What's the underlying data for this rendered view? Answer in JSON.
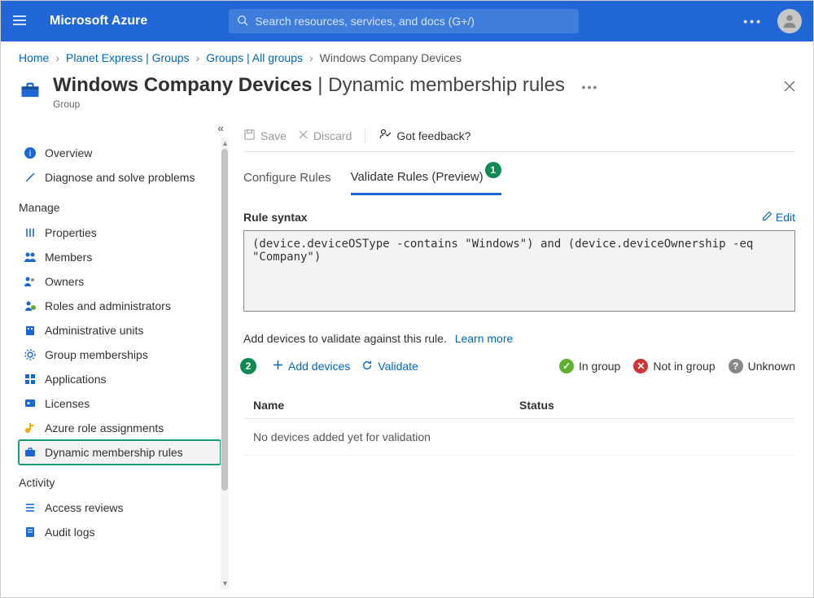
{
  "topbar": {
    "brand": "Microsoft Azure",
    "search_placeholder": "Search resources, services, and docs (G+/)"
  },
  "breadcrumb": {
    "items": [
      "Home",
      "Planet Express | Groups",
      "Groups | All groups",
      "Windows Company Devices"
    ]
  },
  "page": {
    "title_bold": "Windows Company Devices",
    "title_sep": " | ",
    "title_thin": "Dynamic membership rules",
    "subtitle": "Group"
  },
  "toolbar": {
    "save_label": "Save",
    "discard_label": "Discard",
    "feedback_label": "Got feedback?"
  },
  "tabs": {
    "configure": "Configure Rules",
    "validate": "Validate Rules (Preview)",
    "badge1": "1"
  },
  "rule": {
    "section_label": "Rule syntax",
    "edit_label": "Edit",
    "text": "(device.deviceOSType -contains \"Windows\") and (device.deviceOwnership -eq \"Company\")"
  },
  "validate": {
    "hint": "Add devices to validate against this rule.",
    "learn_more": "Learn more",
    "add_devices": "Add devices",
    "validate_btn": "Validate",
    "badge2": "2",
    "legend_in": "In group",
    "legend_not": "Not in group",
    "legend_unk": "Unknown"
  },
  "table": {
    "col_name": "Name",
    "col_status": "Status",
    "empty": "No devices added yet for validation"
  },
  "sidebar": {
    "overview": "Overview",
    "diagnose": "Diagnose and solve problems",
    "manage_label": "Manage",
    "properties": "Properties",
    "members": "Members",
    "owners": "Owners",
    "roles": "Roles and administrators",
    "admin_units": "Administrative units",
    "group_memberships": "Group memberships",
    "applications": "Applications",
    "licenses": "Licenses",
    "azure_role": "Azure role assignments",
    "dynamic_rules": "Dynamic membership rules",
    "activity_label": "Activity",
    "access_reviews": "Access reviews",
    "audit_logs": "Audit logs"
  }
}
